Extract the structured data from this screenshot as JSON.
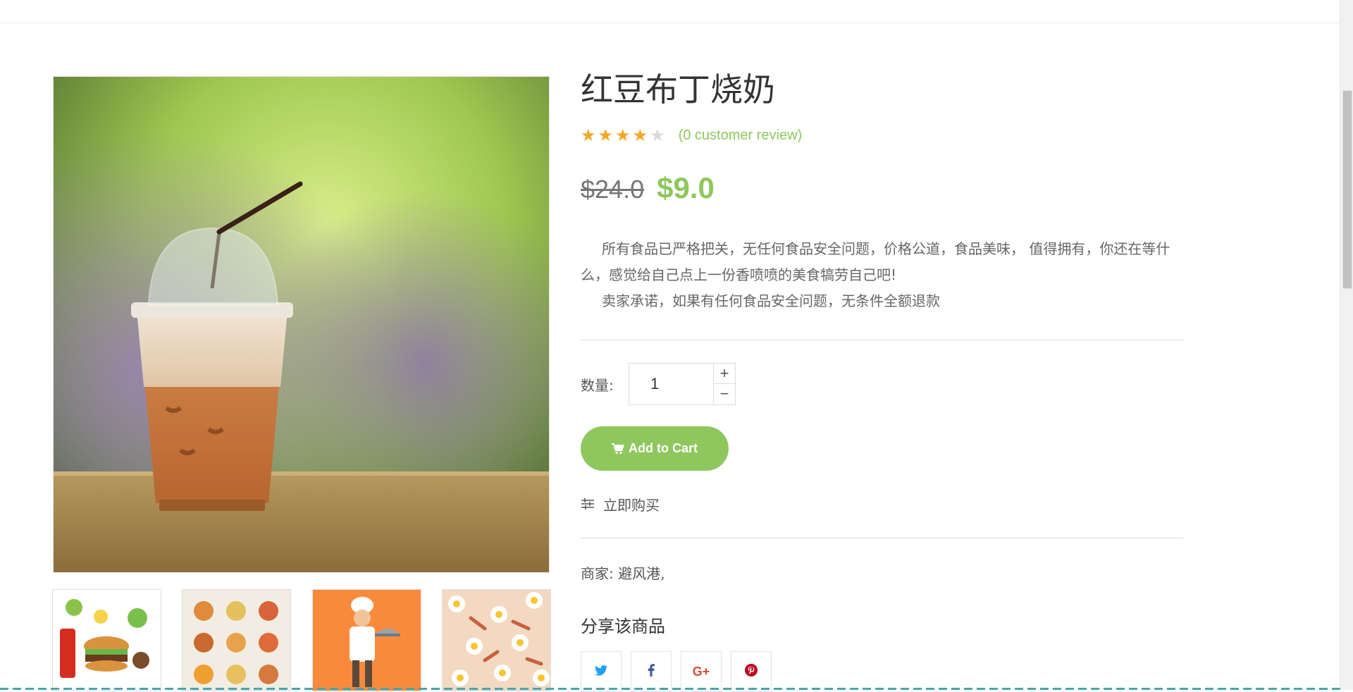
{
  "product": {
    "title": "红豆布丁烧奶",
    "rating": 4,
    "rating_max": 5,
    "review_link": "(0 customer review)",
    "old_price": "$24.0",
    "price": "$9.0",
    "description": [
      "所有食品已严格把关，无任何食品安全问题，价格公道，食品美味， 值得拥有，你还在等什么，感觉给自己点上一份香喷喷的美食犒劳自己吧!",
      "卖家承诺，如果有任何食品安全问题，无条件全额退款"
    ],
    "merchant_label": "商家:",
    "merchant_value": "避风港,"
  },
  "quantity": {
    "label": "数量:",
    "value": "1",
    "plus": "+",
    "minus": "−"
  },
  "actions": {
    "add_to_cart": "Add to Cart",
    "buy_now": "立即购买"
  },
  "share": {
    "title": "分享该商品",
    "networks": [
      {
        "name": "twitter",
        "icon": "twitter-icon",
        "color": "#1da1f2"
      },
      {
        "name": "facebook",
        "icon": "facebook-icon",
        "color": "#3b5998"
      },
      {
        "name": "google-plus",
        "icon": "google-plus-icon",
        "color": "#dd4b39"
      },
      {
        "name": "pinterest",
        "icon": "pinterest-icon",
        "color": "#bd081c"
      }
    ]
  },
  "gallery": {
    "thumbnails": [
      "burger-collage",
      "food-plates",
      "chef-illustration",
      "eggs-bacon-pattern"
    ]
  },
  "colors": {
    "accent": "#8ec75e",
    "star_filled": "#f5a623",
    "star_empty": "#d9d9d9"
  }
}
